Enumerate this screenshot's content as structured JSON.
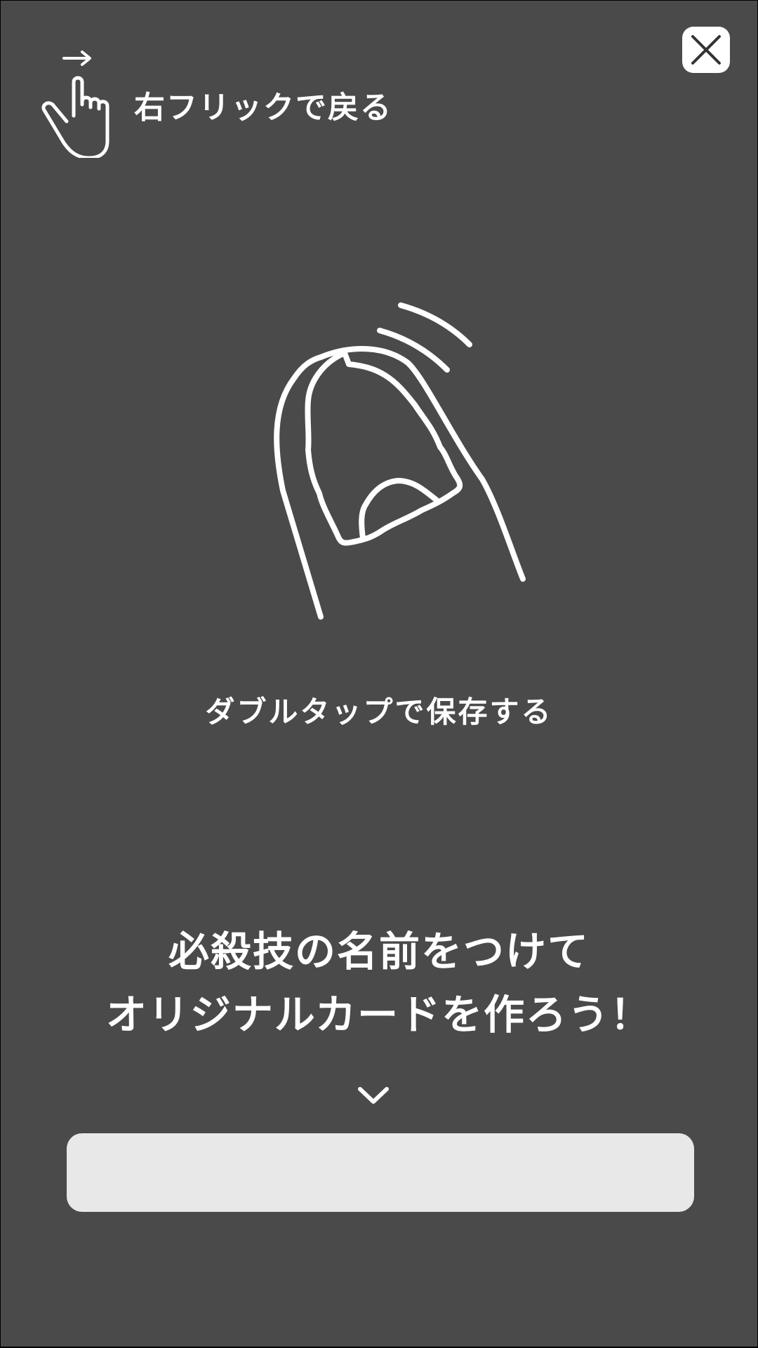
{
  "gesture_hint": {
    "label": "右フリックで戻る",
    "icon": "hand-swipe-right-icon",
    "arrow_glyph": "→"
  },
  "close_button": {
    "icon": "close-icon"
  },
  "tap_illustration": {
    "icon": "double-tap-finger-icon"
  },
  "tap_hint": {
    "label": "ダブルタップで保存する"
  },
  "headline": {
    "line1": "必殺技の名前をつけて",
    "line2": "オリジナルカードを作ろう！"
  },
  "scroll_indicator": {
    "icon": "chevron-down-icon"
  },
  "name_input": {
    "value": "",
    "placeholder": ""
  },
  "colors": {
    "background": "#4a4a4a",
    "foreground": "#ffffff",
    "input_background": "#e8e8e8"
  }
}
